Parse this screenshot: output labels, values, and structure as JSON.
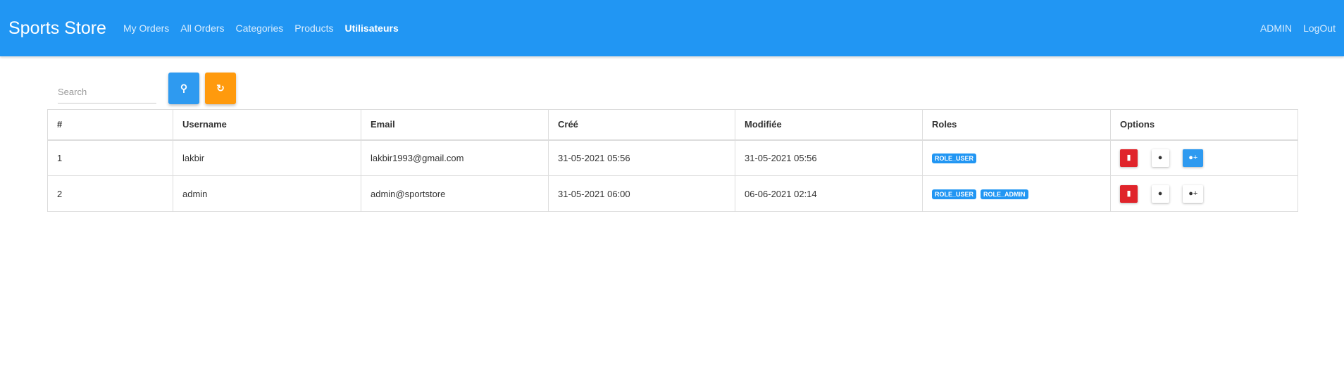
{
  "nav": {
    "brand": "Sports Store",
    "links": [
      "My Orders",
      "All Orders",
      "Categories",
      "Products",
      "Utilisateurs"
    ],
    "active": "Utilisateurs",
    "right": [
      "ADMIN",
      "LogOut"
    ]
  },
  "search": {
    "placeholder": "Search"
  },
  "table": {
    "headers": [
      "#",
      "Username",
      "Email",
      "Créé",
      "Modifiée",
      "Roles",
      "Options"
    ],
    "rows": [
      {
        "id": "1",
        "username": "lakbir",
        "email": "lakbir1993@gmail.com",
        "created": "31-05-2021 05:56",
        "modified": "31-05-2021 05:56",
        "roles": [
          "ROLE_USER"
        ]
      },
      {
        "id": "2",
        "username": "admin",
        "email": "admin@sportstore",
        "created": "31-05-2021 06:00",
        "modified": "06-06-2021 02:14",
        "roles": [
          "ROLE_USER",
          "ROLE_ADMIN"
        ]
      }
    ]
  }
}
